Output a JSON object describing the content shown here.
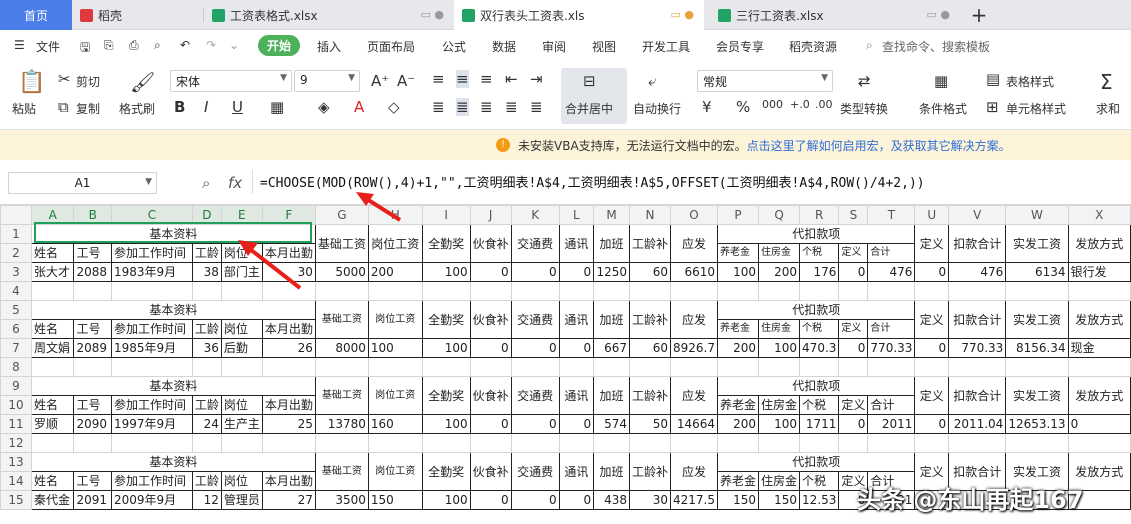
{
  "tabs": [
    {
      "label": "首页",
      "color": "#4a7de8"
    },
    {
      "label": "稻壳",
      "color": "#e0383e"
    },
    {
      "label": "工资表格式.xlsx",
      "color": "#21a366"
    },
    {
      "label": "双行表头工资表.xls",
      "color": "#21a366"
    },
    {
      "label": "三行工资表.xlsx",
      "color": "#21a366"
    }
  ],
  "tab_add": "+",
  "menu": {
    "file": "文件",
    "start": "开始",
    "items": [
      "插入",
      "页面布局",
      "公式",
      "数据",
      "审阅",
      "视图",
      "开发工具",
      "会员专享",
      "稻壳资源"
    ],
    "search": "查找命令、搜索模板"
  },
  "ribbon": {
    "paste": "粘贴",
    "cut": "剪切",
    "copy": "复制",
    "format_painter": "格式刷",
    "font": "宋体",
    "size": "9",
    "merge": "合并居中",
    "wrap": "自动换行",
    "number_format": "常规",
    "type_convert": "类型转换",
    "cond_format": "条件格式",
    "table_style": "表格样式",
    "cell_style": "单元格样式",
    "sum": "求和",
    "bold": "B",
    "italic": "I",
    "underline": "U"
  },
  "infobar": {
    "text": "未安装VBA支持库，无法运行文档中的宏。",
    "link": "点击这里了解如何启用宏，及获取其它解决方案。"
  },
  "namebox": "A1",
  "fx": "fx",
  "formula": "=CHOOSE(MOD(ROW(),4)+1,\"\",工资明细表!A$4,工资明细表!A$5,OFFSET(工资明细表!A$4,ROW()/4+2,))",
  "columns": [
    "A",
    "B",
    "C",
    "D",
    "E",
    "F",
    "G",
    "H",
    "I",
    "J",
    "K",
    "L",
    "M",
    "N",
    "O",
    "P",
    "Q",
    "R",
    "S",
    "T",
    "U",
    "V",
    "W",
    "X"
  ],
  "rows": [
    "1",
    "2",
    "3",
    "4",
    "5",
    "6",
    "7",
    "8",
    "9",
    "10",
    "11",
    "12",
    "13",
    "14",
    "15"
  ],
  "sheet": {
    "group1": "基本资料",
    "group2": "代扣款项",
    "h_name": "姓名",
    "h_id": "工号",
    "h_date": "参加工作时间",
    "h_years": "工龄",
    "h_post": "岗位",
    "h_days": "本月出勤",
    "h_basic": "基础工资",
    "h_postpay": "岗位工资",
    "h_full": "全勤奖",
    "h_meal": "伙食补",
    "h_traffic": "交通费",
    "h_comm": "通讯",
    "h_ot": "加班",
    "h_senior": "工龄补",
    "h_due": "应发",
    "h_pension": "养老金",
    "h_house": "住房金",
    "h_tax": "个税",
    "h_def": "定义",
    "h_total": "合计",
    "h_def2": "定义",
    "h_dedsum": "扣款合计",
    "h_net": "实发工资",
    "h_method": "发放方式",
    "records": [
      {
        "name": "张大才",
        "id": "2088",
        "date": "1983年9月",
        "years": "38",
        "post": "部门主",
        "days": "30",
        "basic": "5000",
        "postpay": "200",
        "full": "100",
        "meal": "0",
        "traffic": "0",
        "comm": "0",
        "ot": "1250",
        "senior": "60",
        "due": "6610",
        "pension": "100",
        "house": "200",
        "tax": "176",
        "def": "0",
        "total": "476",
        "def2": "0",
        "dedsum": "476",
        "net": "6134",
        "method": "银行发"
      },
      {
        "name": "周文娟",
        "id": "2089",
        "date": "1985年9月",
        "years": "36",
        "post": "后勤",
        "days": "26",
        "basic": "8000",
        "postpay": "100",
        "full": "100",
        "meal": "0",
        "traffic": "0",
        "comm": "0",
        "ot": "667",
        "senior": "60",
        "due": "8926.7",
        "pension": "200",
        "house": "100",
        "tax": "470.3",
        "def": "0",
        "total": "770.33",
        "def2": "0",
        "dedsum": "770.33",
        "net": "8156.34",
        "method": "现金"
      },
      {
        "name": "罗顺",
        "id": "2090",
        "date": "1997年9月",
        "years": "24",
        "post": "生产主",
        "days": "25",
        "basic": "13780",
        "postpay": "160",
        "full": "100",
        "meal": "0",
        "traffic": "0",
        "comm": "0",
        "ot": "574",
        "senior": "50",
        "due": "14664",
        "pension": "200",
        "house": "100",
        "tax": "1711",
        "def": "0",
        "total": "2011",
        "def2": "0",
        "dedsum": "2011.04",
        "net": "12653.13",
        "method": "0"
      },
      {
        "name": "秦代金",
        "id": "2091",
        "date": "2009年9月",
        "years": "12",
        "post": "管理员",
        "days": "27",
        "basic": "3500",
        "postpay": "150",
        "full": "100",
        "meal": "0",
        "traffic": "0",
        "comm": "0",
        "ot": "438",
        "senior": "30",
        "due": "4217.5",
        "pension": "150",
        "house": "150",
        "tax": "12.53",
        "def": "0",
        "total": "31",
        "def2": "",
        "dedsum": "",
        "net": "",
        "method": ""
      }
    ]
  },
  "watermark": "头条 @东山再起167"
}
